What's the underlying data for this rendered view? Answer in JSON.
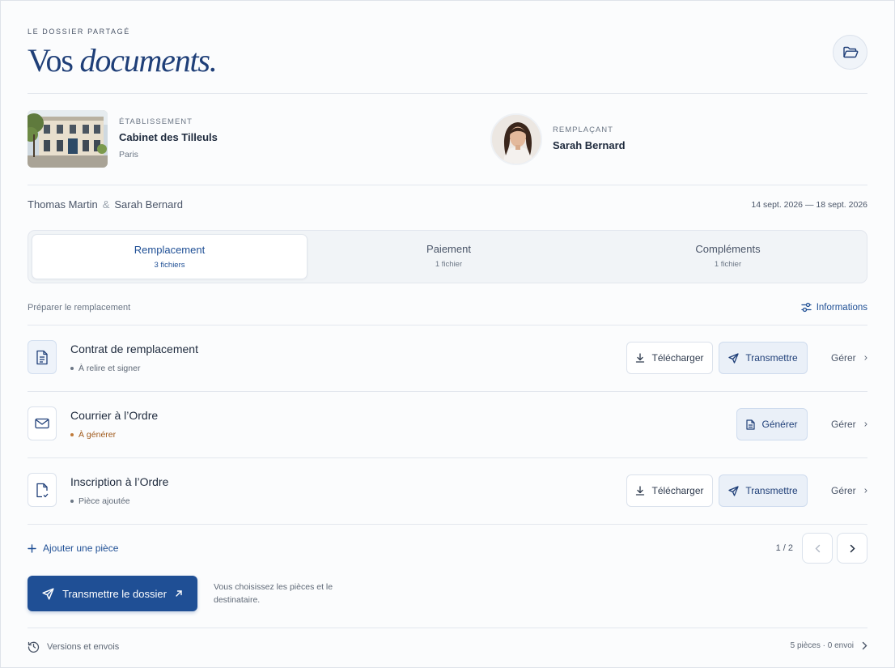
{
  "header": {
    "eyebrow": "LE DOSSIER PARTAGÉ",
    "title_plain": "Vos",
    "title_italic": "documents."
  },
  "etablissement": {
    "label": "ÉTABLISSEMENT",
    "name": "Cabinet des Tilleuls",
    "city": "Paris"
  },
  "remplacant": {
    "label": "REMPLAÇANT",
    "name": "Sarah Bernard"
  },
  "parties": {
    "left": "Thomas Martin",
    "amp": "&",
    "right": "Sarah Bernard"
  },
  "dates": "14 sept. 2026 — 18 sept. 2026",
  "tabs": [
    {
      "label": "Remplacement",
      "sub": "3 fichiers",
      "active": true
    },
    {
      "label": "Paiement",
      "sub": "1 fichier",
      "active": false
    },
    {
      "label": "Compléments",
      "sub": "1 fichier",
      "active": false
    }
  ],
  "section": {
    "label": "Préparer le remplacement",
    "info_link": "Informations"
  },
  "documents": [
    {
      "title": "Contrat de remplacement",
      "status": "À relire et signer",
      "icon": "document-icon"
    },
    {
      "title": "Courrier à l’Ordre",
      "status": "À générer",
      "icon": "mail-icon"
    },
    {
      "title": "Inscription à l’Ordre",
      "status": "Pièce ajoutée",
      "icon": "file-check-icon"
    }
  ],
  "actions": {
    "download": "Télécharger",
    "transmit": "Transmettre",
    "generate": "Générer",
    "manage": "Gérer"
  },
  "add_piece": "Ajouter une pièce",
  "pagination": "1 / 2",
  "cta": {
    "label": "Transmettre le dossier",
    "note": "Vous choisissez les pièces et le destinataire."
  },
  "footer": {
    "left": "Versions et envois",
    "right": "5 pièces · 0 envoi"
  },
  "colors": {
    "accent": "#1f4f95",
    "title": "#1f3f78",
    "warning": "#a05a1c"
  }
}
